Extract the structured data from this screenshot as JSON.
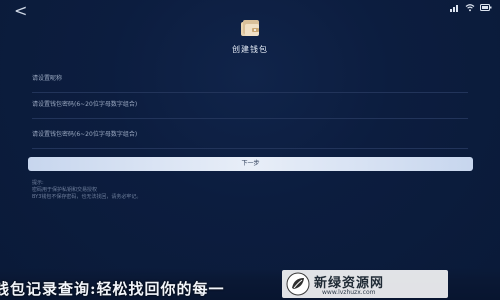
{
  "icons": {
    "back": "back-arrow-icon",
    "wallet": "wallet-icon",
    "signal": "signal-icon",
    "wifi": "wifi-icon",
    "battery": "battery-icon",
    "watermark_logo": "leaf-logo-icon"
  },
  "header": {
    "back_label": "<",
    "title": "创建钱包"
  },
  "form": {
    "wallet_name_placeholder": "请设置昵称",
    "password_placeholder": "请设置钱包密码(6~20位字母数字组合)",
    "password_confirm_placeholder": "请设置钱包密码(6~20位字母数字组合)",
    "next_button": "下一步"
  },
  "notes": {
    "heading": "提示:",
    "line1": "密码用于保护私钥和交易授权",
    "line2": "BY3钱包不保存密码，也无法找回，请务必牢记。"
  },
  "banner": {
    "text": "钱包记录查询:轻松找回你的每一"
  },
  "watermark": {
    "title": "新绿资源网",
    "url": "www.lvzhuzx.com"
  },
  "colors": {
    "background": "#0c1d3f",
    "button": "#d6e1f3",
    "text_primary": "#e6edf7",
    "text_muted": "#9aa8c0"
  }
}
